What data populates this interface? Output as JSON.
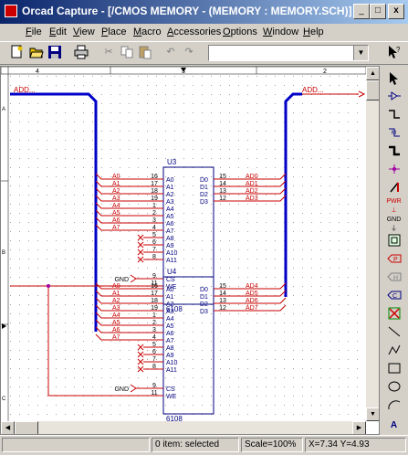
{
  "window": {
    "title": "Orcad Capture - [/CMOS MEMORY - (MEMORY : MEMORY.SCH)]",
    "min_label": "_",
    "max_label": "□",
    "close_label": "x"
  },
  "menu": {
    "items": [
      {
        "u": "F",
        "rest": "ile"
      },
      {
        "u": "E",
        "rest": "dit"
      },
      {
        "u": "V",
        "rest": "iew"
      },
      {
        "u": "P",
        "rest": "lace"
      },
      {
        "u": "M",
        "rest": "acro"
      },
      {
        "u": "A",
        "rest": "ccessories"
      },
      {
        "u": "O",
        "rest": "ptions"
      },
      {
        "u": "W",
        "rest": "indow"
      },
      {
        "u": "H",
        "rest": "elp"
      }
    ]
  },
  "schematic": {
    "left_bus": "ADD...",
    "right_bus": "ADD...",
    "border_cols": [
      "4",
      "3",
      "2"
    ],
    "border_rows": [
      "A",
      "B",
      "C"
    ],
    "u3": {
      "ref": "U3",
      "part": "6108",
      "a_nets": [
        "A0",
        "A1",
        "A2",
        "A3",
        "A4",
        "A5",
        "A6",
        "A7"
      ],
      "a_pins": [
        "16",
        "17",
        "18",
        "19",
        "1",
        "2",
        "3",
        "4"
      ],
      "a_labels": [
        "A0",
        "A1",
        "A2",
        "A3",
        "A4",
        "A5",
        "A6",
        "A7",
        "A8",
        "A9",
        "A10",
        "A11"
      ],
      "nc_pins": [
        "5",
        "6",
        "7",
        "8"
      ],
      "d_labels": [
        "D0",
        "D1",
        "D2",
        "D3"
      ],
      "d_pins": [
        "15",
        "14",
        "13",
        "12"
      ],
      "d_nets": [
        "AD0",
        "AD1",
        "AD2",
        "AD3"
      ],
      "cs_pin": "9",
      "we_pin": "11",
      "cs_label": "CS",
      "we_label": "WE",
      "gnd": "GND"
    },
    "u4": {
      "ref": "U4",
      "part": "6108",
      "a_nets": [
        "A0",
        "A1",
        "A2",
        "A3",
        "A4",
        "A5",
        "A6",
        "A7"
      ],
      "a_pins": [
        "16",
        "17",
        "18",
        "19",
        "1",
        "2",
        "3",
        "4"
      ],
      "a_labels": [
        "A0",
        "A1",
        "A2",
        "A3",
        "A4",
        "A5",
        "A6",
        "A7",
        "A8",
        "A9",
        "A10",
        "A11"
      ],
      "nc_pins": [
        "5",
        "6",
        "7",
        "8"
      ],
      "d_labels": [
        "D0",
        "D1",
        "D2",
        "D3"
      ],
      "d_pins": [
        "15",
        "14",
        "13",
        "12"
      ],
      "d_nets": [
        "AD4",
        "AD5",
        "AD6",
        "AD7"
      ],
      "cs_pin": "9",
      "we_pin": "11",
      "cs_label": "CS",
      "we_label": "WE",
      "gnd": "GND"
    }
  },
  "palette": {
    "part_label": "PWR",
    "gnd_label": "GND"
  },
  "status": {
    "items": "0 item: selected",
    "scale": "Scale=100%",
    "coords": "X=7.34  Y=4.93"
  },
  "colors": {
    "title_start": "#0a246a",
    "title_end": "#a6caf0",
    "bus": "#0000c8",
    "wire": "#c80000",
    "part": "#000080",
    "canvas": "#ffffff"
  }
}
